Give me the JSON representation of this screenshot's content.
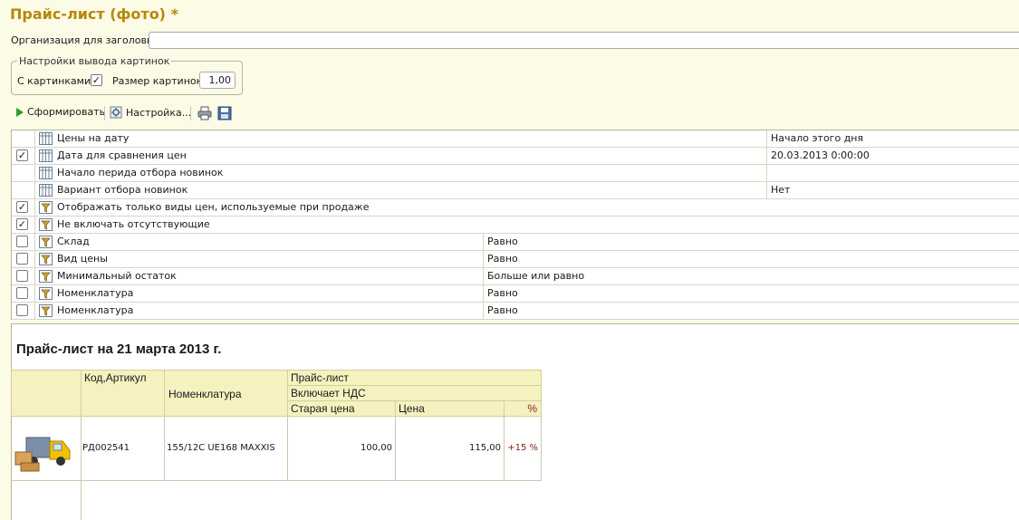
{
  "window": {
    "title": "Прайс-лист (фото) *"
  },
  "org": {
    "label": "Организация для заголовка:",
    "value": ""
  },
  "pictures_group": {
    "caption": "Настройки вывода  картинок",
    "with_pictures_label": "С картинками:",
    "with_pictures_checked": true,
    "size_label": "Размер картинок:",
    "size_value": "1,00"
  },
  "toolbar": {
    "generate_label": "Сформировать",
    "settings_label": "Настройка...",
    "icons": [
      "play-icon",
      "gear-icon",
      "print-icon",
      "save-icon"
    ]
  },
  "settings_rows": [
    {
      "checkbox": false,
      "checked": false,
      "icon": "parameter-icon",
      "name": "Цены на дату",
      "condition": "",
      "value": "Начало этого дня"
    },
    {
      "checkbox": true,
      "checked": true,
      "icon": "parameter-icon",
      "name": "Дата для сравнения цен",
      "condition": "",
      "value": "20.03.2013 0:00:00"
    },
    {
      "checkbox": false,
      "checked": false,
      "icon": "parameter-icon",
      "name": "Начало перида отбора новинок",
      "condition": "",
      "value": ""
    },
    {
      "checkbox": false,
      "checked": false,
      "icon": "parameter-icon",
      "name": "Вариант отбора новинок",
      "condition": "",
      "value": "Нет"
    },
    {
      "checkbox": true,
      "checked": true,
      "icon": "filter-icon",
      "name": "Отображать только виды цен, используемые при продаже",
      "condition": "",
      "value": ""
    },
    {
      "checkbox": true,
      "checked": true,
      "icon": "filter-icon",
      "name": "Не включать отсутствующие",
      "condition": "",
      "value": ""
    },
    {
      "checkbox": true,
      "checked": false,
      "icon": "filter-icon",
      "name": "Склад",
      "condition": "Равно",
      "value": ""
    },
    {
      "checkbox": true,
      "checked": false,
      "icon": "filter-icon",
      "name": "Вид цены",
      "condition": "Равно",
      "value": ""
    },
    {
      "checkbox": true,
      "checked": false,
      "icon": "filter-icon",
      "name": "Минимальный остаток",
      "condition": "Больше или равно",
      "value": ""
    },
    {
      "checkbox": true,
      "checked": false,
      "icon": "filter-icon",
      "name": "Номенклатура",
      "condition": "Равно",
      "value": ""
    },
    {
      "checkbox": true,
      "checked": false,
      "icon": "filter-icon",
      "name": "Номенклатура",
      "condition": "Равно",
      "value": ""
    }
  ],
  "report": {
    "title": "Прайс-лист на 21 марта 2013 г.",
    "headers": {
      "code": "Код,Артикул",
      "nomenclature": "Номенклатура",
      "price_list": "Прайс-лист",
      "vat": "Включает НДС",
      "old_price": "Старая цена",
      "price": "Цена",
      "percent": "%"
    },
    "rows": [
      {
        "image": "truck-boxes-icon",
        "code": "РД002541",
        "nomenclature": "155/12С  UE168 MAXXIS",
        "old_price": "100,00",
        "price": "115,00",
        "percent": "+15 %"
      }
    ],
    "colors": {
      "percent": "#8b1a1a",
      "header_bg": "#f5f2c0"
    }
  },
  "colors": {
    "title": "#b8860b",
    "background": "#fbfbe6"
  }
}
